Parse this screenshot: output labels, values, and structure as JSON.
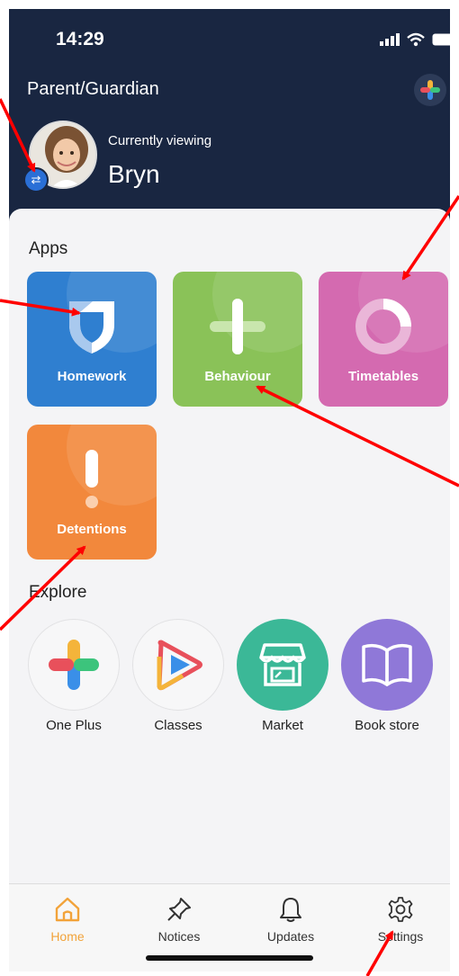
{
  "status_bar": {
    "time": "14:29"
  },
  "header": {
    "role": "Parent/Guardian",
    "viewing_label": "Currently viewing",
    "viewing_name": "Bryn"
  },
  "apps": {
    "section_label": "Apps",
    "items": [
      {
        "label": "Homework",
        "icon": "shield-icon",
        "color": "#2f7fd0"
      },
      {
        "label": "Behaviour",
        "icon": "plus-icon",
        "color": "#8ac258"
      },
      {
        "label": "Timetables",
        "icon": "donut-icon",
        "color": "#d46ab0"
      },
      {
        "label": "Detentions",
        "icon": "exclamation-icon",
        "color": "#f2883c"
      }
    ]
  },
  "explore": {
    "section_label": "Explore",
    "items": [
      {
        "label": "One Plus",
        "icon": "one-plus-icon"
      },
      {
        "label": "Classes",
        "icon": "play-icon"
      },
      {
        "label": "Market",
        "icon": "storefront-icon",
        "color": "#3bb897"
      },
      {
        "label": "Book store",
        "icon": "book-icon",
        "color": "#8f78d8"
      }
    ]
  },
  "bottom_nav": {
    "items": [
      {
        "label": "Home",
        "icon": "home-icon",
        "active": true
      },
      {
        "label": "Notices",
        "icon": "pin-icon"
      },
      {
        "label": "Updates",
        "icon": "bell-icon"
      },
      {
        "label": "Settings",
        "icon": "gear-icon"
      }
    ],
    "active_color": "#f2a33a"
  },
  "annotation_color": "#ff0000"
}
